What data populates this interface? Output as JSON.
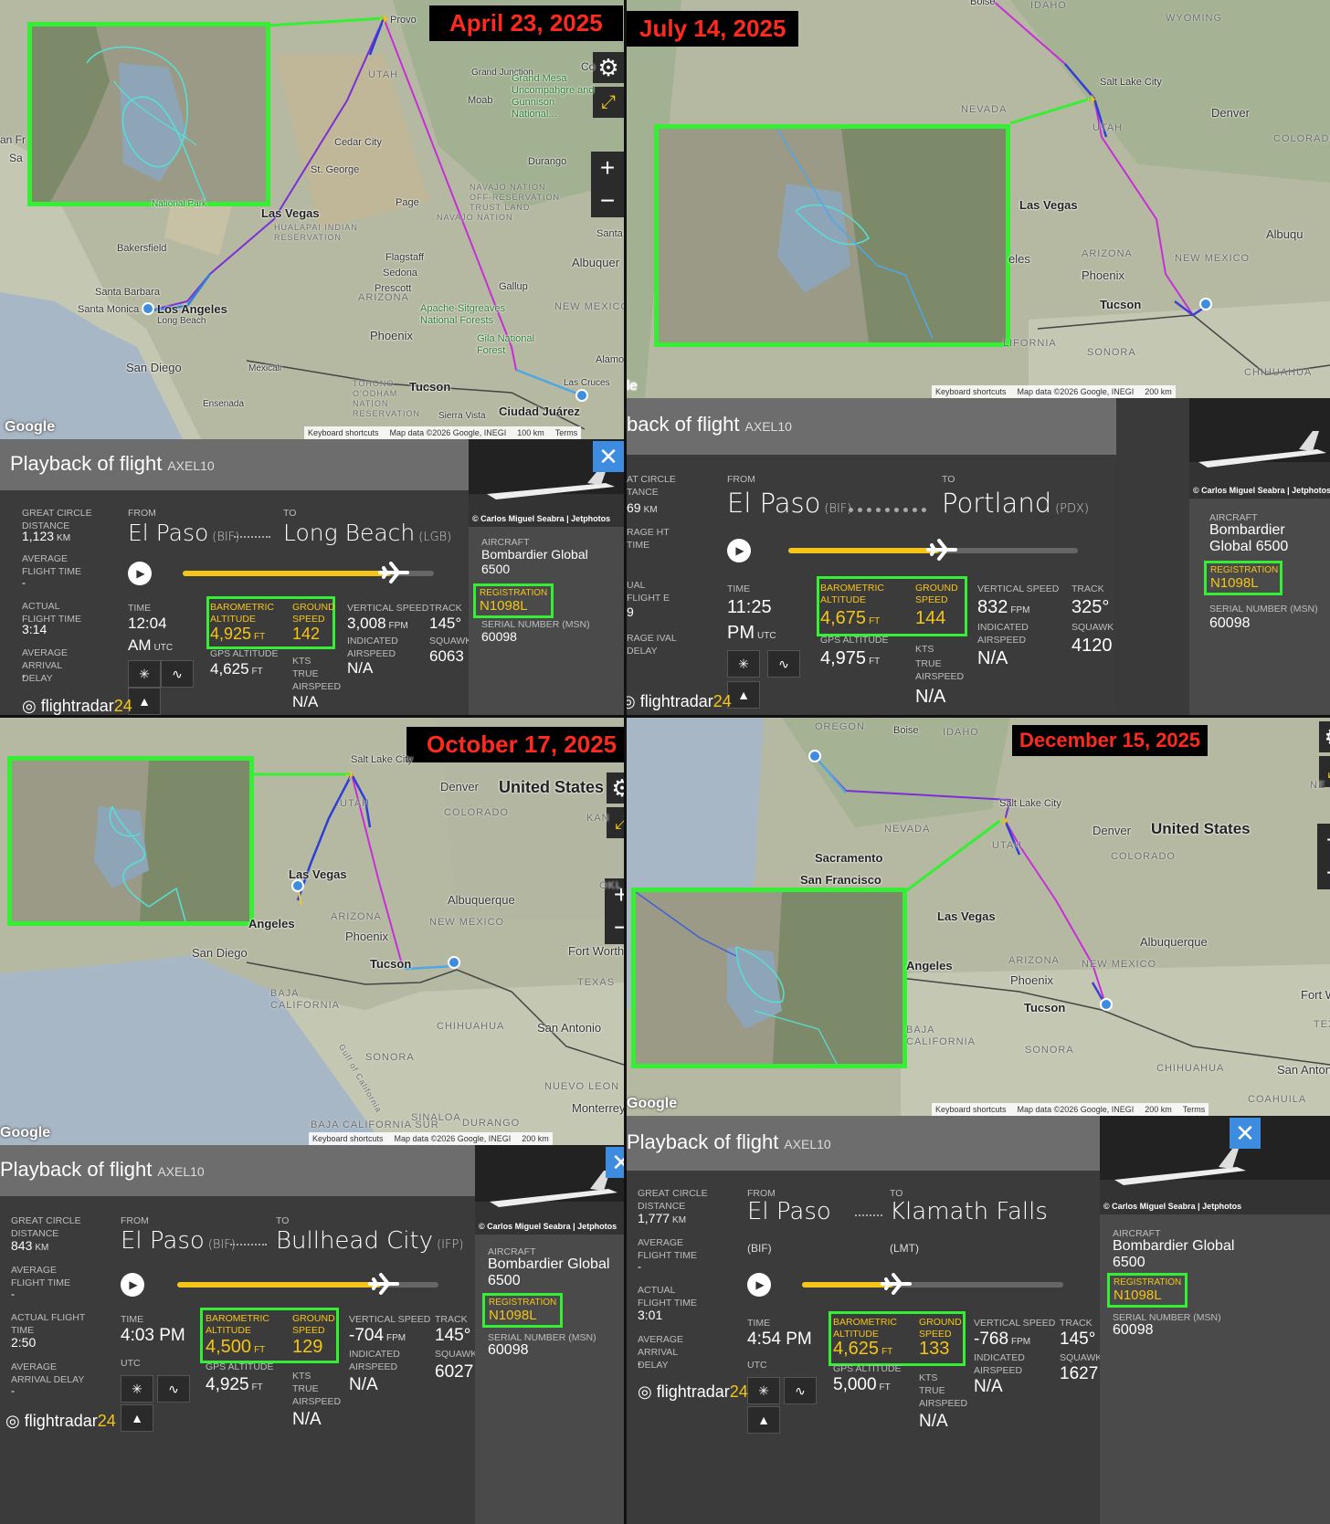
{
  "common": {
    "panel_title": "Playback of flight",
    "callsign": "AXEL10",
    "from_label": "FROM",
    "to_label": "TO",
    "time_label": "TIME",
    "baro_label": "BAROMETRIC ALTITUDE",
    "ground_label": "GROUND SPEED",
    "vs_label": "VERTICAL SPEED",
    "track_label": "TRACK",
    "squawk_label": "SQUAWK",
    "gps_label": "GPS ALTITUDE",
    "ias_label": "INDICATED AIRSPEED",
    "tas_label": "TRUE AIRSPEED",
    "kts": "KTS",
    "ft": "FT",
    "fpm": "FPM",
    "km": "KM",
    "na": "N/A",
    "gcd_label": "GREAT CIRCLE DISTANCE",
    "aft_label": "AVERAGE FLIGHT TIME",
    "act_label": "ACTUAL FLIGHT TIME",
    "aad_label": "AVERAGE ARRIVAL DELAY",
    "dash": "-",
    "aircraft_label": "AIRCRAFT",
    "aircraft": "Bombardier Global 6500",
    "reg_label": "REGISTRATION",
    "registration": "N1098L",
    "msn_label": "SERIAL NUMBER (MSN)",
    "msn": "60098",
    "photo_credit": "© Carlos Miguel Seabra | Jetphotos",
    "logo_a": "flightradar",
    "logo_b": "24",
    "google": "Google",
    "keyboard": "Keyboard shortcuts",
    "mapdata": "Map data ©2026 Google, INEGI",
    "terms": "Terms",
    "close": "✕",
    "gear": "⚙",
    "plus": "+",
    "minus": "−",
    "expand": "⤢"
  },
  "q1": {
    "date": "April 23, 2025",
    "from": "El Paso",
    "from_code": "(BIF)",
    "to": "Long Beach",
    "to_code": "(LGB)",
    "gcd": "1,123",
    "act": "3:14",
    "time": "12:04",
    "time2": "AM",
    "utc": "UTC",
    "baro": "4,925",
    "gs": "142",
    "vs": "3,008",
    "track": "145°",
    "squawk": "6063",
    "gps": "4,625",
    "scale": "100 km",
    "progress": 0.83,
    "labels": [
      "Provo",
      "UTAH",
      "Grand Junction",
      "Moab",
      "Grand Mesa Uncompahgre and Gunnison National...",
      "Cedar City",
      "St. George",
      "Durango",
      "NAVAJO NATION OFF-RESERVATION TRUST LAND",
      "NAVAJO NATION",
      "Page",
      "Las Vegas",
      "HUALAPAI INDIAN RESERVATION",
      "Bakersfield",
      "Flagstaff",
      "Sedona",
      "Prescott",
      "ARIZONA",
      "Santa Barbara",
      "Los Angeles",
      "Santa Monica",
      "Long Beach",
      "Apache-Sitgreaves National Forests",
      "NEW MEXICO",
      "Phoenix",
      "Gila National Forest",
      "San Diego",
      "Mexicali",
      "Tucson",
      "TOHONO O'ODHAM NATION RESERVATION",
      "Ensenada",
      "Sierra Vista",
      "Las Cruces",
      "Ciudad Juárez",
      "Albuquer",
      "Gallup",
      "Santa",
      "Alamo",
      "Co",
      "an Fr",
      "Sa",
      "National Park"
    ]
  },
  "q2": {
    "date": "July 14, 2025",
    "from": "El Paso",
    "from_code": "(BIF)",
    "to": "Portland",
    "to_code": "(PDX)",
    "gcd_partial": "69",
    "act_partial": "9",
    "gcd_label_partial": "AT CIRCLE TANCE",
    "aft_label_partial": "RAGE HT TIME",
    "act_label_partial": "UAL FLIGHT E",
    "aad_label_partial": "RAGE IVAL DELAY",
    "title_partial": "back of flight",
    "time": "11:25",
    "time2": "PM",
    "utc": "UTC",
    "baro": "4,675",
    "gs": "144",
    "vs": "832",
    "track": "325°",
    "squawk": "4120",
    "gps": "4,975",
    "scale": "200 km",
    "progress": 0.52,
    "labels": [
      "Boise",
      "IDAHO",
      "WYOMING",
      "Salt Lake City",
      "NEVADA",
      "Denver",
      "UTAH",
      "COLORADO",
      "Las Vegas",
      "Albuqu",
      "ARIZONA",
      "NEW MEXICO",
      "Phoenix",
      "Tucson",
      "SONORA",
      "CHIHUAHUA",
      "eles",
      "LIFORNIA",
      "le"
    ]
  },
  "q3": {
    "date": "October 17, 2025",
    "from": "El Paso",
    "from_code": "(BIF)",
    "to": "Bullhead City",
    "to_code": "(IFP)",
    "gcd": "843",
    "act": "2:50",
    "time": "4:03 PM",
    "utc": "UTC",
    "baro": "4,500",
    "gs": "129",
    "vs": "-704",
    "track": "145°",
    "squawk": "6027",
    "gps": "4,925",
    "scale": "200 km",
    "progress": 0.78,
    "labels": [
      "Salt Lake City",
      "UTAH",
      "Denver",
      "United States",
      "COLORADO",
      "Las Vegas",
      "KAN",
      "Albuquerque",
      "ARIZONA",
      "NEW MEXICO",
      "Phoenix",
      "Angeles",
      "OKL",
      "San Diego",
      "Tucson",
      "Fort Worth",
      "BAJA CALIFORNIA",
      "TEXAS",
      "CHIHUAHUA",
      "San Antonio",
      "SONORA",
      "Gulf of California",
      "NUEVO LEON",
      "Monterrey",
      "BAJA CALIFORNIA SUR",
      "SINALOA",
      "DURANGO",
      "Google"
    ]
  },
  "q4": {
    "date": "December 15, 2025",
    "from": "El Paso",
    "from_code": "(BIF)",
    "to": "Klamath Falls",
    "to_code": "(LMT)",
    "gcd": "1,777",
    "act": "3:01",
    "time": "4:54 PM",
    "utc": "UTC",
    "baro": "4,625",
    "gs": "133",
    "vs": "-768",
    "track": "145°",
    "squawk": "1627",
    "gps": "5,000",
    "scale": "200 km",
    "progress": 0.35,
    "labels": [
      "OREGON",
      "Boise",
      "IDAHO",
      "NE",
      "Salt Lake City",
      "NEVADA",
      "Denver",
      "United States",
      "Sacramento",
      "UTAH",
      "COLORADO",
      "San Francisco",
      "Las Vegas",
      "Albuquerque",
      "Angeles",
      "ARIZONA",
      "NEW MEXICO",
      "Phoenix",
      "Fort W",
      "Tucson",
      "TEX",
      "BAJA CALIFORNIA",
      "SONORA",
      "CHIHUAHUA",
      "San Anton",
      "COAHUILA"
    ]
  }
}
